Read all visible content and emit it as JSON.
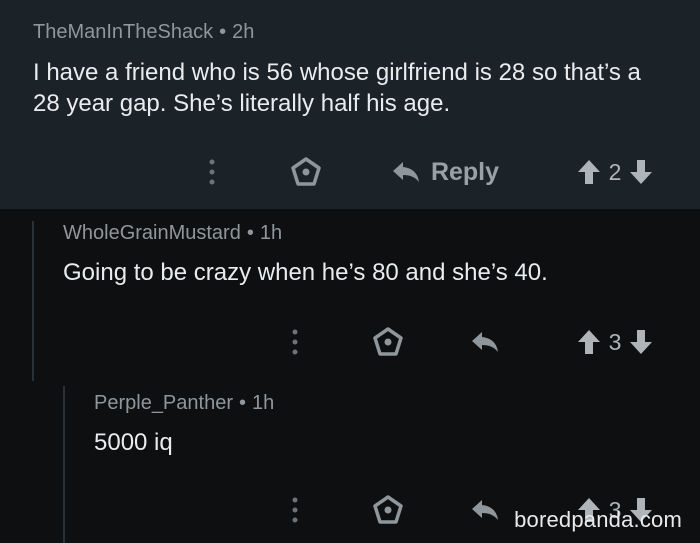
{
  "comments": [
    {
      "username": "TheManInTheShack",
      "age": "2h",
      "separator": "•",
      "text": "I have a friend who is 56 whose girlfriend is 28 so that’s a 28 year gap. She’s literally half his age.",
      "reply_label": "Reply",
      "score": "2"
    },
    {
      "username": "WholeGrainMustard",
      "age": "1h",
      "separator": "•",
      "text": "Going to be crazy when he’s 80 and she’s 40.",
      "score": "3"
    },
    {
      "username": "Perple_Panther",
      "age": "1h",
      "separator": "•",
      "text": "5000 iq",
      "score": "3"
    }
  ],
  "watermark": "boredpanda.com",
  "icons": [
    "more-vertical-icon",
    "award-icon",
    "reply-arrow-icon",
    "upvote-icon",
    "downvote-icon"
  ]
}
